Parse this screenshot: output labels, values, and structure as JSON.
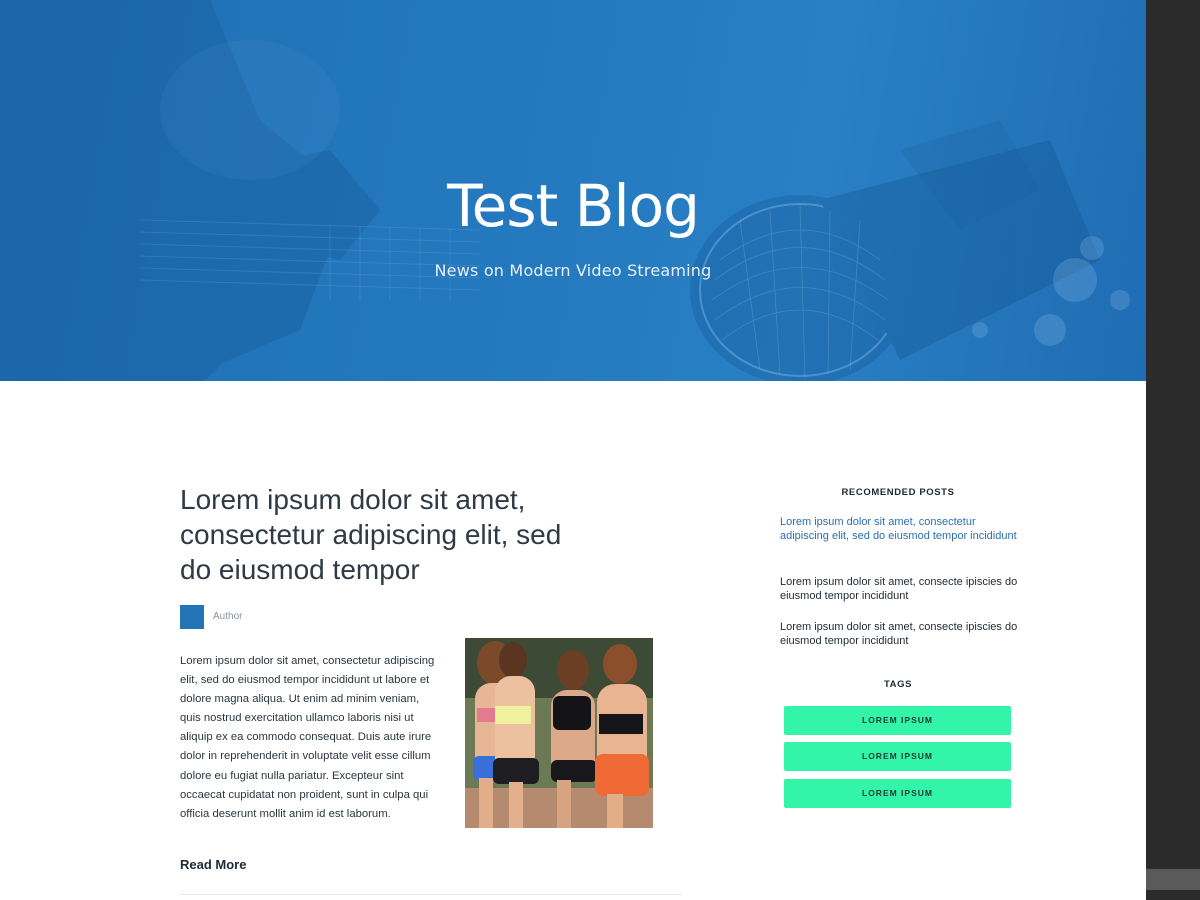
{
  "hero": {
    "title": "Test Blog",
    "subtitle": "News on Modern Video Streaming",
    "bg_color": "#2378bc"
  },
  "post": {
    "title": "Lorem ipsum dolor sit amet, consectetur adipiscing elit, sed do eiusmod tempor",
    "author": "Author",
    "excerpt": "Lorem ipsum dolor sit amet, consectetur adipiscing elit, sed do eiusmod tempor incididunt ut labore et dolore magna aliqua. Ut enim ad minim veniam, quis nostrud exercitation ullamco laboris nisi ut aliquip ex ea commodo consequat. Duis aute irure dolor in reprehenderit in voluptate velit esse cillum dolore eu fugiat nulla pariatur. Excepteur sint occaecat cupidatat non proident, sunt in culpa qui officia deserunt mollit anim id est laborum.",
    "read_more": "Read More"
  },
  "sidebar": {
    "recommended_heading": "RECOMENDED POSTS",
    "recommended": [
      "Lorem ipsum dolor sit amet, consectetur adipiscing elit, sed do eiusmod tempor incididunt",
      "Lorem ipsum dolor sit amet, consecte ipiscies do eiusmod tempor incididunt",
      "Lorem ipsum dolor sit amet, consecte ipiscies do eiusmod tempor incididunt"
    ],
    "tags_heading": "TAGS",
    "tags": [
      "LOREM IPSUM",
      "LOREM IPSUM",
      "LOREM IPSUM"
    ]
  },
  "colors": {
    "accent": "#2374b5",
    "tag": "#33f5a9",
    "link": "#2c6fb0"
  }
}
